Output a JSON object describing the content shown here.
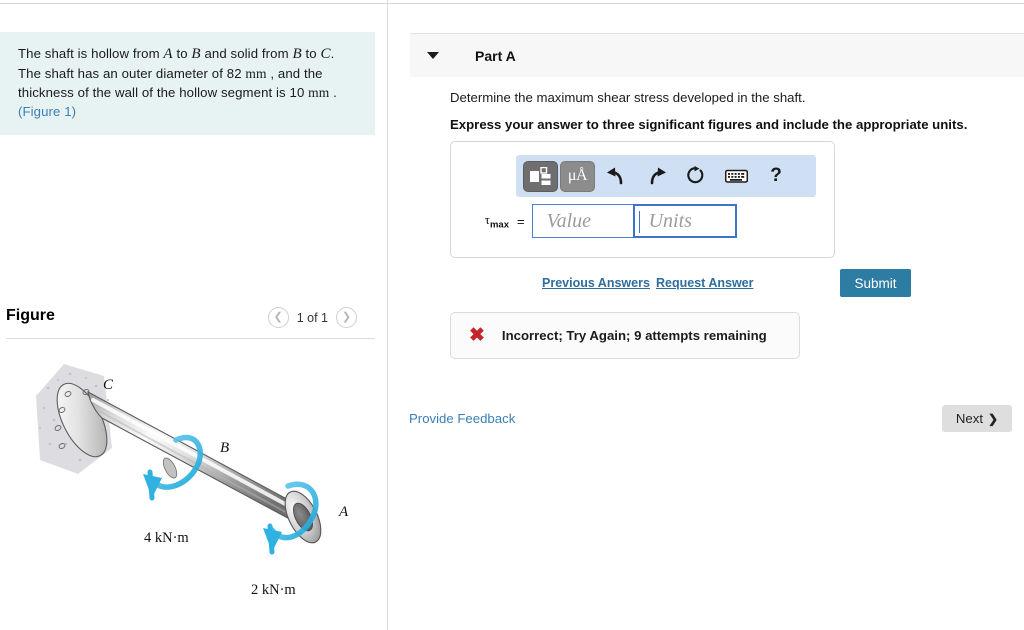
{
  "left": {
    "question": {
      "line1_a": "The shaft is hollow from ",
      "var_A": "A",
      "line1_b": " to ",
      "var_B": "B",
      "line1_c": " and solid from ",
      "var_B2": "B",
      "line1_d": " to ",
      "var_C": "C",
      "line1_e": ".",
      "line2_a": "The shaft has an outer diameter of 82 ",
      "unit_mm1": "mm",
      "line2_b": " , and the",
      "line3_a": "thickness of the wall of the hollow segment is 10 ",
      "unit_mm2": "mm",
      "line3_b": " .",
      "figure_link": "(Figure 1)"
    },
    "figure": {
      "title": "Figure",
      "pager_prev_icon": "chevron-left-icon",
      "pager_label": "1 of 1",
      "pager_next_icon": "chevron-right-icon",
      "labels": {
        "point_a": "A",
        "point_b": "B",
        "point_c": "C",
        "torque_b": "4 kN·m",
        "torque_a": "2 kN·m"
      }
    }
  },
  "right": {
    "part": {
      "caret_icon": "caret-down-icon",
      "title": "Part A"
    },
    "prompt": "Determine the maximum shear stress developed in the shaft.",
    "prompt_bold": "Express your answer to three significant figures and include the appropriate units.",
    "toolbar": {
      "template_icon": "math-template-icon",
      "units_label": "μÅ",
      "undo_icon": "undo-icon",
      "redo_icon": "redo-icon",
      "reset_icon": "reset-icon",
      "keyboard_icon": "keyboard-icon",
      "help_label": "?"
    },
    "answer": {
      "symbol": "τ",
      "subscript": "max",
      "equals": "=",
      "value_placeholder": "Value",
      "units_placeholder": "Units",
      "value_current": "",
      "units_current": ""
    },
    "actions": {
      "submit_label": "Submit",
      "previous_answers_label": "Previous Answers",
      "request_answer_label": "Request Answer"
    },
    "feedback": {
      "icon": "x-mark-icon",
      "message": "Incorrect; Try Again; 9 attempts remaining"
    },
    "footer": {
      "provide_feedback_label": "Provide Feedback",
      "next_label": "Next",
      "next_icon": "chevron-right-icon"
    }
  },
  "colors": {
    "question_bg": "#e7f3f2",
    "link": "#3a7fb5",
    "submit_bg": "#2d7ca4",
    "error_red": "#c4252b",
    "toolbar_bg": "#cfe0f5",
    "focus_blue": "#3f72c9",
    "torque_cyan": "#3ab4e0"
  }
}
